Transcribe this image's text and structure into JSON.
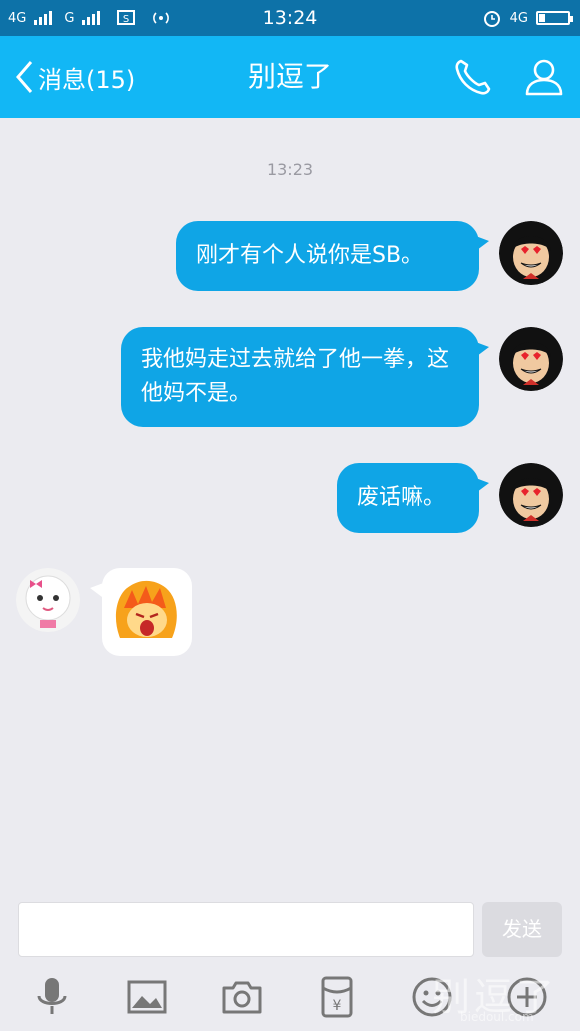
{
  "status_bar": {
    "carrier1": "4G",
    "carrier2": "G",
    "time": "13:24",
    "right_network": "4G"
  },
  "header": {
    "back_label": "消息(15)",
    "title": "别逗了",
    "accent_color": "#12b7f5"
  },
  "chat": {
    "timestamp": "13:23",
    "messages": [
      {
        "side": "right",
        "text": "刚才有个人说你是SB。"
      },
      {
        "side": "right",
        "text": "我他妈走过去就给了他一拳，这他妈不是。"
      },
      {
        "side": "right",
        "text": "废话嘛。"
      },
      {
        "side": "left",
        "type": "sticker",
        "sticker": "angry-face-sticker"
      }
    ]
  },
  "input": {
    "send_label": "发送"
  },
  "toolbar": {
    "items": [
      "microphone-icon",
      "image-icon",
      "camera-icon",
      "red-packet-icon",
      "emoji-icon",
      "plus-icon"
    ]
  },
  "watermark": {
    "text": "别逗了",
    "url": "biedoul.com"
  }
}
